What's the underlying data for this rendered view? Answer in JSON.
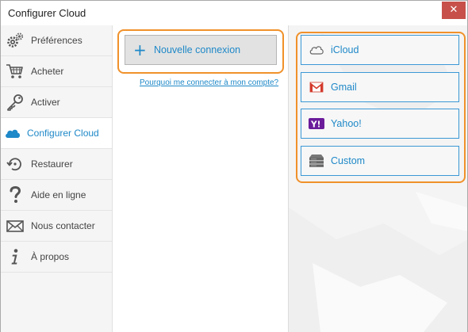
{
  "window": {
    "title": "Configurer Cloud",
    "close_glyph": "✕"
  },
  "sidebar": {
    "items": [
      {
        "label": "Préférences",
        "icon": "gears-icon"
      },
      {
        "label": "Acheter",
        "icon": "cart-icon"
      },
      {
        "label": "Activer",
        "icon": "key-icon"
      },
      {
        "label": "Configurer Cloud",
        "icon": "cloud-icon",
        "active": true
      },
      {
        "label": "Restaurer",
        "icon": "restore-icon"
      },
      {
        "label": "Aide en ligne",
        "icon": "question-icon"
      },
      {
        "label": "Nous contacter",
        "icon": "envelope-icon"
      },
      {
        "label": "À propos",
        "icon": "info-icon"
      }
    ]
  },
  "connections": {
    "new_button": {
      "icon_glyph": "+",
      "label": "Nouvelle connexion"
    },
    "help_link": "Pourquoi me connecter à mon compte?"
  },
  "providers": [
    {
      "label": "iCloud",
      "icon": "icloud-icon"
    },
    {
      "label": "Gmail",
      "icon": "gmail-icon"
    },
    {
      "label": "Yahoo!",
      "icon": "yahoo-icon"
    },
    {
      "label": "Custom",
      "icon": "server-icon"
    }
  ],
  "colors": {
    "accent": "#1e88c8",
    "highlight": "#f0912a",
    "close": "#c7504a",
    "gmail_red": "#d33a2c",
    "yahoo_purple": "#6a1b9a"
  }
}
